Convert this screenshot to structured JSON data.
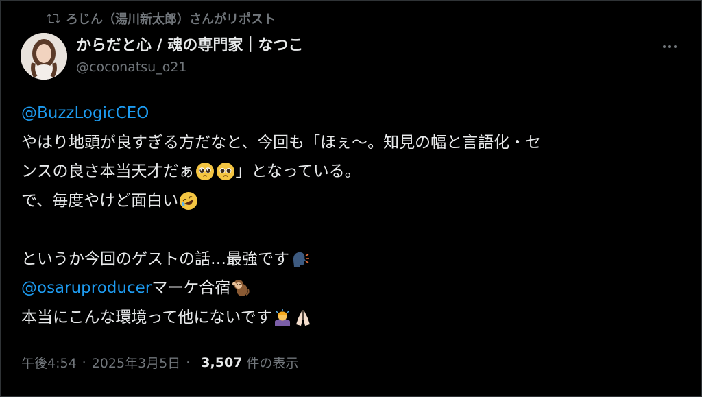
{
  "repost": {
    "text": "ろじん（湯川新太郎）さんがリポスト"
  },
  "author": {
    "display_name": "からだと心 / 魂の専門家｜なつこ",
    "handle": "@coconatsu_o21"
  },
  "tweet": {
    "mention1": "@BuzzLogicCEO",
    "line2": "やはり地頭が良すぎる方だなと、今回も「ほぇ〜。知見の幅と言語化・セ",
    "line3a": "ンスの良さ本当天才だぁ",
    "line3b": "」となっている。",
    "line4": "で、毎度やけど面白い",
    "line6": "というか今回のゲストの話…最強です",
    "mention2": "@osaruproducer",
    "line7b": " マーケ合宿",
    "line8": "本当にこんな環境って他にないです"
  },
  "meta": {
    "time": "午後4:54",
    "dot1": "·",
    "date": "2025年3月5日",
    "dot2": "·",
    "views": "3,507",
    "views_label": "件の表示"
  },
  "icons": {
    "repost": "repost-icon",
    "more": "more-icon",
    "emoji_pleading": "pleading-face-emoji",
    "emoji_rofl": "rofl-emoji",
    "emoji_speaking": "speaking-head-emoji",
    "emoji_monkey": "monkey-emoji",
    "emoji_bow": "bowing-person-emoji",
    "emoji_pray": "folded-hands-emoji"
  },
  "colors": {
    "background": "#000000",
    "text": "#e7e9ea",
    "secondary": "#71767b",
    "link": "#1d9bf0"
  }
}
